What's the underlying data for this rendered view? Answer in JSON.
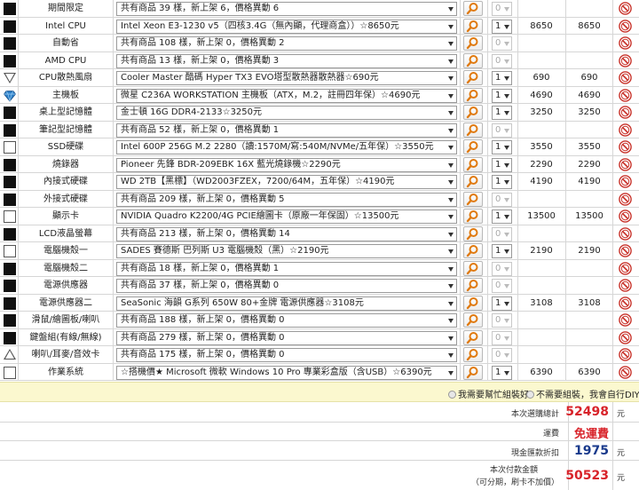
{
  "rows": [
    {
      "icon": "box-filled",
      "name": "期間限定",
      "select": "共有商品 39 樣，新上架 6，價格異動 6",
      "qty": "0",
      "qty_disabled": true,
      "price": "",
      "subtotal": ""
    },
    {
      "icon": "box-filled",
      "name": "Intel CPU",
      "select": "Intel Xeon E3-1230 v5（四核3.4G（無內顯，代理商盒））☆8650元",
      "qty": "1",
      "qty_disabled": false,
      "price": "8650",
      "subtotal": "8650"
    },
    {
      "icon": "box-filled",
      "name": "自動省",
      "select": "共有商品 108 樣，新上架 0，價格異動 2",
      "qty": "0",
      "qty_disabled": true,
      "price": "",
      "subtotal": ""
    },
    {
      "icon": "box-filled",
      "name": "AMD CPU",
      "select": "共有商品 13 樣，新上架 0，價格異動 3",
      "qty": "0",
      "qty_disabled": true,
      "price": "",
      "subtotal": ""
    },
    {
      "icon": "triangle-down",
      "name": "CPU散熱風扇",
      "select": "Cooler Master 酷碼 Hyper TX3 EVO塔型散熱器散熱器☆690元",
      "qty": "1",
      "qty_disabled": false,
      "price": "690",
      "subtotal": "690"
    },
    {
      "icon": "diamond",
      "name": "主機板",
      "select": "微星 C236A WORKSTATION 主機板（ATX，M.2，註冊四年保）☆4690元",
      "qty": "1",
      "qty_disabled": false,
      "price": "4690",
      "subtotal": "4690"
    },
    {
      "icon": "box-filled",
      "name": "桌上型記憶體",
      "select": "金士頓 16G DDR4-2133☆3250元",
      "qty": "1",
      "qty_disabled": false,
      "price": "3250",
      "subtotal": "3250"
    },
    {
      "icon": "box-filled",
      "name": "筆記型記憶體",
      "select": "共有商品 52 樣，新上架 0，價格異動 1",
      "qty": "0",
      "qty_disabled": true,
      "price": "",
      "subtotal": ""
    },
    {
      "icon": "box-empty",
      "name": "SSD硬碟",
      "select": "Intel 600P 256G M.2 2280（讀:1570M/寫:540M/NVMe/五年保）☆3550元",
      "qty": "1",
      "qty_disabled": false,
      "price": "3550",
      "subtotal": "3550"
    },
    {
      "icon": "box-filled",
      "name": "燒錄器",
      "select": "Pioneer 先鋒 BDR-209EBK 16X 藍光燒錄機☆2290元",
      "qty": "1",
      "qty_disabled": false,
      "price": "2290",
      "subtotal": "2290"
    },
    {
      "icon": "box-filled",
      "name": "內接式硬碟",
      "select": "WD 2TB【黑標】（WD2003FZEX，7200/64M，五年保）☆4190元",
      "qty": "1",
      "qty_disabled": false,
      "price": "4190",
      "subtotal": "4190"
    },
    {
      "icon": "box-filled",
      "name": "外接式硬碟",
      "select": "共有商品 209 樣，新上架 0，價格異動 5",
      "qty": "0",
      "qty_disabled": true,
      "price": "",
      "subtotal": ""
    },
    {
      "icon": "box-empty",
      "name": "顯示卡",
      "select": "NVIDIA Quadro K2200/4G PCIE繪圖卡（原廠一年保固）☆13500元",
      "qty": "1",
      "qty_disabled": false,
      "price": "13500",
      "subtotal": "13500"
    },
    {
      "icon": "box-filled",
      "name": "LCD液晶螢幕",
      "select": "共有商品 213 樣，新上架 0，價格異動 14",
      "qty": "0",
      "qty_disabled": true,
      "price": "",
      "subtotal": ""
    },
    {
      "icon": "box-empty",
      "name": "電腦機殼一",
      "select": "SADES 賽德斯 巴列斯 U3 電腦機殼（黑）☆2190元",
      "qty": "1",
      "qty_disabled": false,
      "price": "2190",
      "subtotal": "2190"
    },
    {
      "icon": "box-filled",
      "name": "電腦機殼二",
      "select": "共有商品 18 樣，新上架 0，價格異動 1",
      "qty": "0",
      "qty_disabled": true,
      "price": "",
      "subtotal": ""
    },
    {
      "icon": "box-filled",
      "name": "電源供應器",
      "select": "共有商品 37 樣，新上架 0，價格異動 0",
      "qty": "0",
      "qty_disabled": true,
      "price": "",
      "subtotal": ""
    },
    {
      "icon": "box-filled",
      "name": "電源供應器二",
      "select": "SeaSonic 海韻 G系列 650W 80+金牌 電源供應器☆3108元",
      "qty": "1",
      "qty_disabled": false,
      "price": "3108",
      "subtotal": "3108"
    },
    {
      "icon": "box-filled",
      "name": "滑鼠/繪圖板/喇叭",
      "select": "共有商品 188 樣，新上架 0，價格異動 0",
      "qty": "0",
      "qty_disabled": true,
      "price": "",
      "subtotal": ""
    },
    {
      "icon": "box-filled",
      "name": "鍵盤組(有線/無線)",
      "select": "共有商品 279 樣，新上架 0，價格異動 0",
      "qty": "0",
      "qty_disabled": true,
      "price": "",
      "subtotal": ""
    },
    {
      "icon": "triangle-up",
      "name": "喇叭/耳麥/音效卡",
      "select": "共有商品 175 樣，新上架 0，價格異動 0",
      "qty": "0",
      "qty_disabled": true,
      "price": "",
      "subtotal": ""
    },
    {
      "icon": "box-empty",
      "name": "作業系統",
      "select": "☆搭機價★ Microsoft 微軟 Windows 10 Pro 專業彩盒版（含USB）☆6390元",
      "qty": "1",
      "qty_disabled": false,
      "price": "6390",
      "subtotal": "6390"
    }
  ],
  "diy": {
    "option_need": "我需要幫忙組裝好",
    "option_diy": "不需要組裝，我會自行DIY"
  },
  "summary": {
    "total_label": "本次選購總計",
    "total_value": "52498",
    "shipping_label": "運費",
    "shipping_value": "免運費",
    "cash_discount_label": "現金匯款折扣",
    "cash_discount_value": "1975",
    "pay_label_line1": "本次付款金額",
    "pay_label_line2": "（可分期，刷卡不加價）",
    "pay_value": "50523",
    "unit": "元"
  },
  "colors": {
    "total": "#d8232a",
    "shipping": "#d8232a",
    "discount": "#1a3a8c",
    "pay": "#d8232a",
    "diy_bar": "#fbf8cf",
    "search_orange": "#e07a10",
    "cancel_red": "#c8322a"
  }
}
